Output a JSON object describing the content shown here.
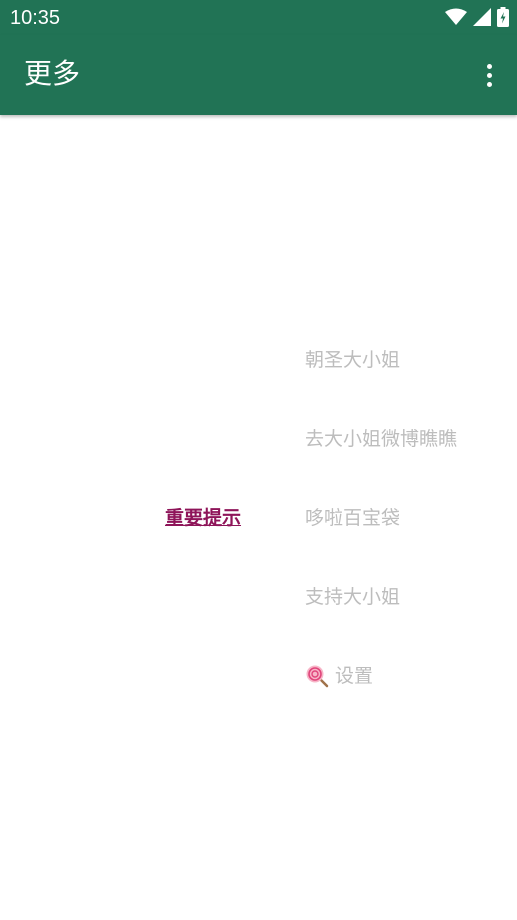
{
  "status_bar": {
    "time": "10:35"
  },
  "app_bar": {
    "title": "更多"
  },
  "notice": {
    "label": "重要提示"
  },
  "menu": {
    "items": [
      {
        "label": "朝圣大小姐"
      },
      {
        "label": "去大小姐微博瞧瞧"
      },
      {
        "label": "哆啦百宝袋"
      },
      {
        "label": "支持大小姐"
      },
      {
        "label": "设置",
        "icon": "lollipop-icon"
      }
    ]
  },
  "colors": {
    "primary": "#217355",
    "link": "#8e1459",
    "menu_text": "#bdbdbd"
  }
}
